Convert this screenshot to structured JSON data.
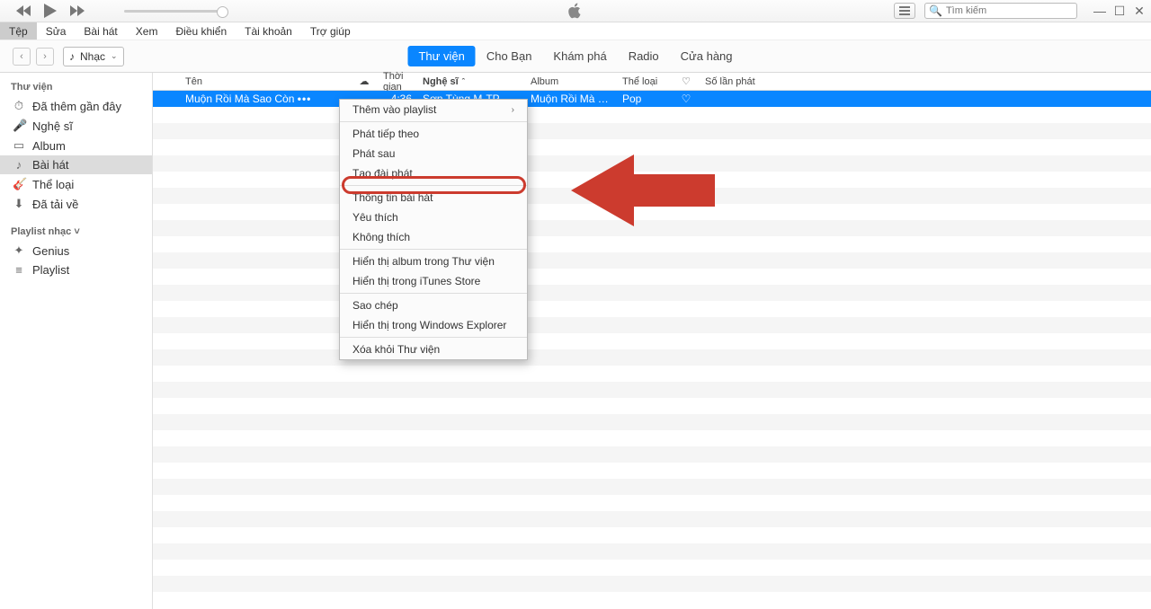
{
  "titlebar": {
    "search_placeholder": "Tìm kiếm"
  },
  "menubar": {
    "items": [
      "Tệp",
      "Sửa",
      "Bài hát",
      "Xem",
      "Điều khiển",
      "Tài khoản",
      "Trợ giúp"
    ],
    "active_index": 0
  },
  "navrow": {
    "media_label": "Nhạc",
    "tabs": [
      "Thư viện",
      "Cho Bạn",
      "Khám phá",
      "Radio",
      "Cửa hàng"
    ],
    "active_tab_index": 0
  },
  "sidebar": {
    "header1": "Thư viện",
    "library_items": [
      {
        "icon": "⏱",
        "label": "Đã thêm gần đây"
      },
      {
        "icon": "🎤",
        "label": "Nghệ sĩ"
      },
      {
        "icon": "▭",
        "label": "Album"
      },
      {
        "icon": "♪",
        "label": "Bài hát"
      },
      {
        "icon": "🎸",
        "label": "Thể loại"
      },
      {
        "icon": "⬇",
        "label": "Đã tải về"
      }
    ],
    "active_lib_index": 3,
    "header2": "Playlist nhạc",
    "playlist_items": [
      {
        "icon": "✦",
        "label": "Genius"
      },
      {
        "icon": "≡",
        "label": "Playlist"
      }
    ]
  },
  "columns": {
    "name": "Tên",
    "cloud_glyph": "☁",
    "time": "Thời gian",
    "artist": "Nghệ sĩ",
    "album": "Album",
    "genre": "Thể loại",
    "heart_glyph": "♡",
    "plays": "Số lần phát",
    "sort_indicator": "ˆ"
  },
  "song_row": {
    "name": "Muộn Rồi Mà Sao Còn",
    "dots": "•••",
    "time": "4:36",
    "artist": "Sơn Tùng M-TP",
    "album": "Muộn Rồi Mà Sao C…",
    "genre": "Pop",
    "heart": "♡"
  },
  "context_menu": {
    "items_group1": [
      {
        "label": "Thêm vào playlist",
        "submenu": true
      }
    ],
    "items_group2": [
      {
        "label": "Phát tiếp theo"
      },
      {
        "label": "Phát sau"
      },
      {
        "label": "Tạo đài phát"
      }
    ],
    "items_group3": [
      {
        "label": "Thông tin bài hát",
        "highlight": true
      },
      {
        "label": "Yêu thích"
      },
      {
        "label": "Không thích"
      }
    ],
    "items_group4": [
      {
        "label": "Hiển thị album trong Thư viện"
      },
      {
        "label": "Hiển thị trong iTunes Store"
      }
    ],
    "items_group5": [
      {
        "label": "Sao chép"
      },
      {
        "label": "Hiển thị trong Windows Explorer"
      }
    ],
    "items_group6": [
      {
        "label": "Xóa khỏi Thư viện"
      }
    ]
  }
}
